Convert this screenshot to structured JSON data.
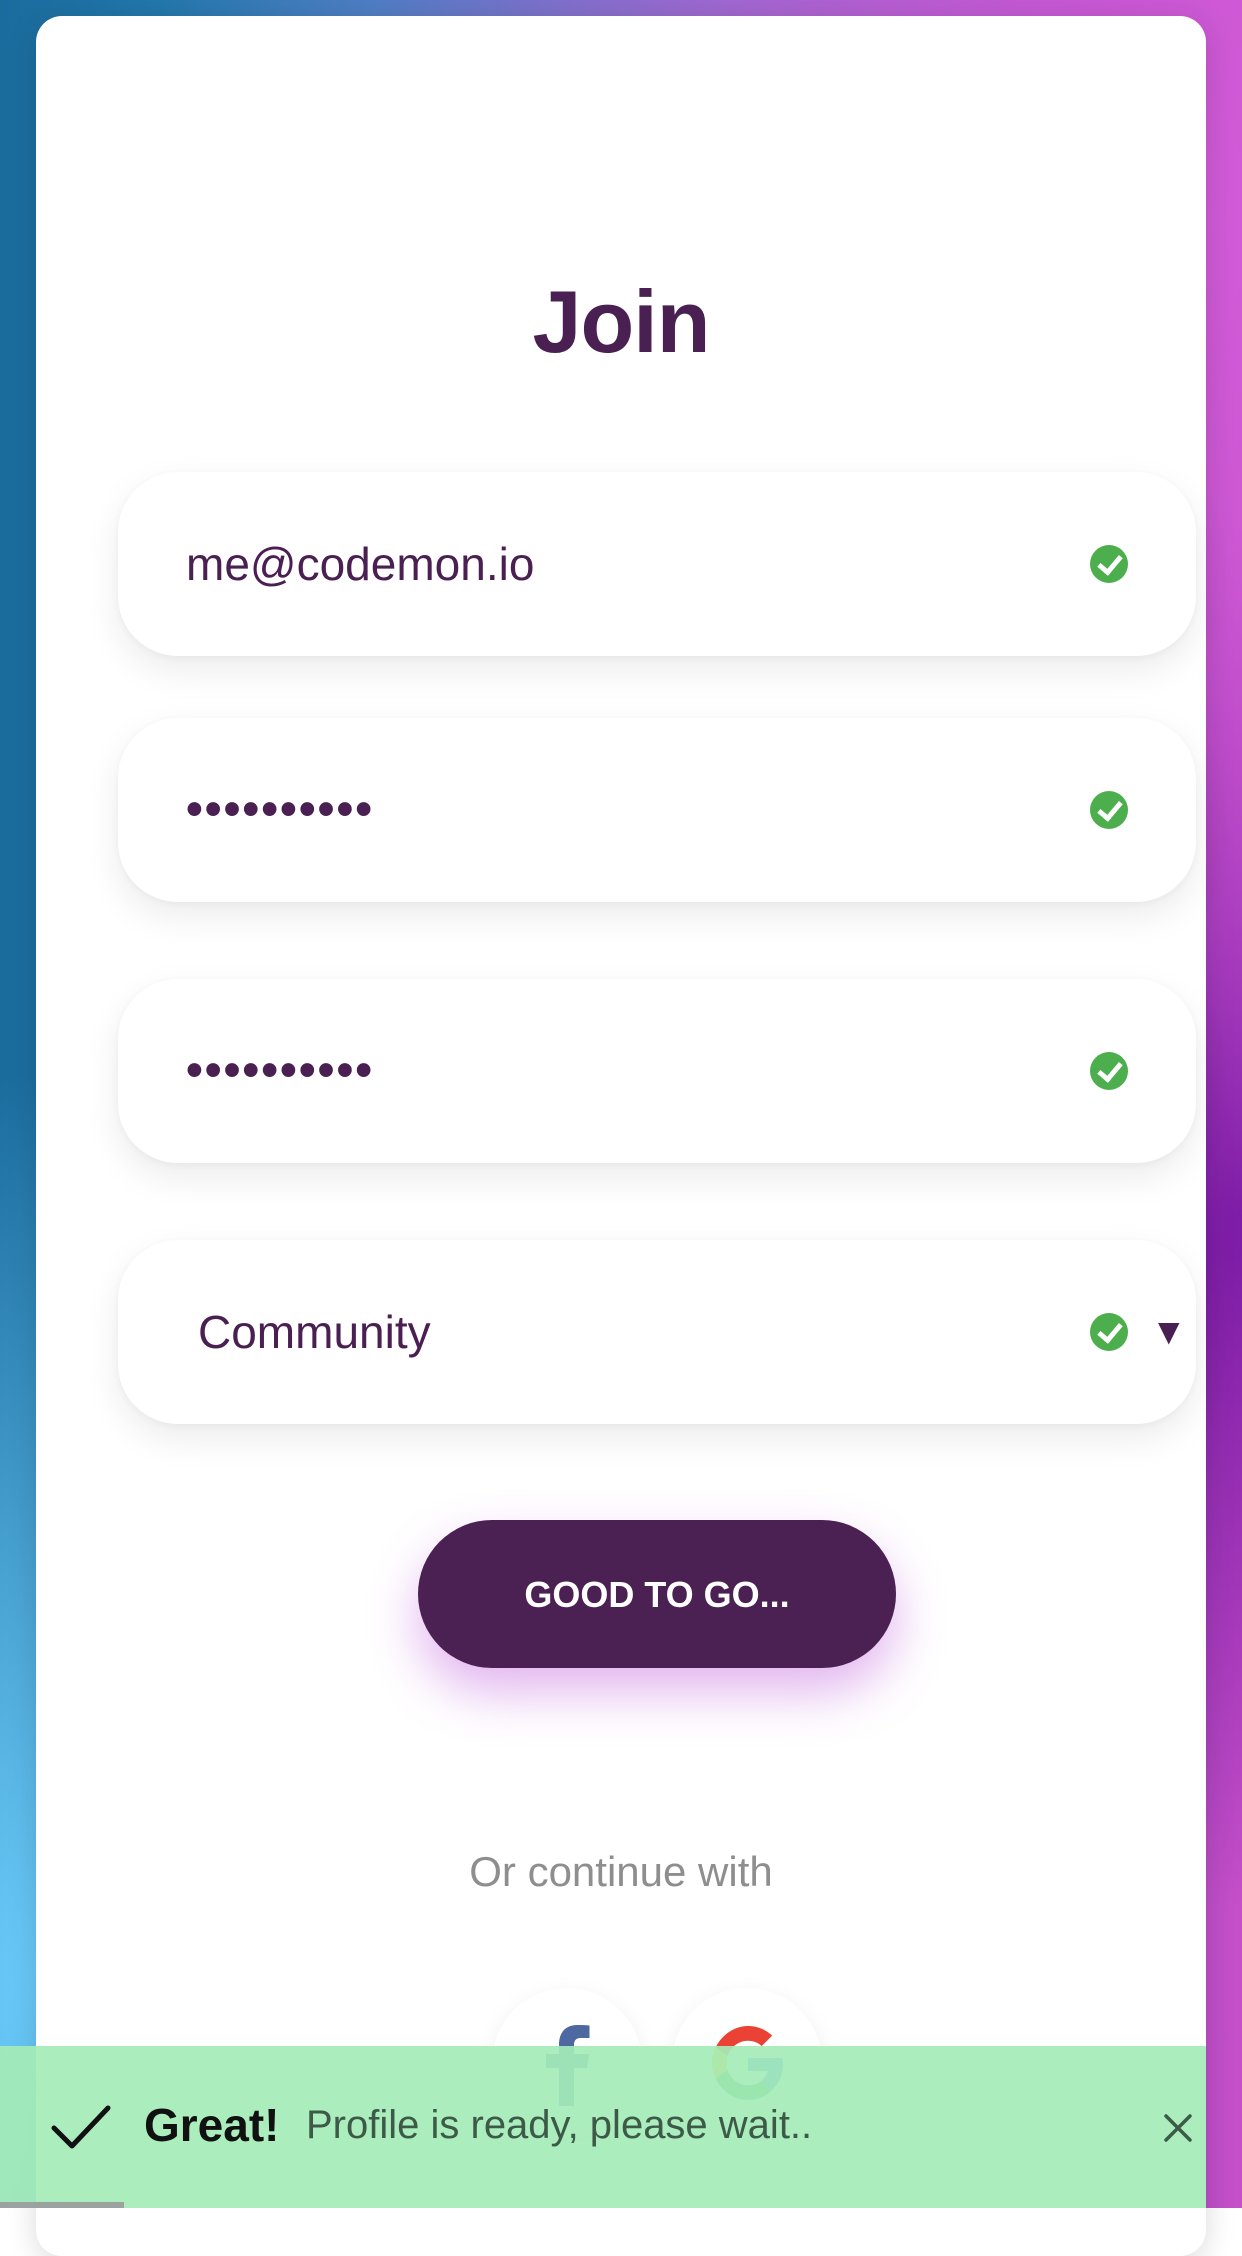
{
  "page": {
    "title": "Join"
  },
  "form": {
    "email": {
      "value": "me@codemon.io",
      "valid": true
    },
    "password": {
      "value": "••••••••••",
      "valid": true
    },
    "confirm_password": {
      "value": "••••••••••",
      "valid": true
    },
    "plan": {
      "selected": "Community",
      "valid": true
    }
  },
  "submit": {
    "label": "GOOD TO GO..."
  },
  "social": {
    "divider_text": "Or continue with",
    "providers": [
      "facebook-icon",
      "google-icon"
    ]
  },
  "toast": {
    "heading": "Great!",
    "message": "Profile is ready, please wait..",
    "icon": "checkmark-icon",
    "close_icon": "close-icon"
  },
  "colors": {
    "accent": "#4a2152",
    "valid": "#4cae4c",
    "toast_bg": "#a4ecb7"
  }
}
